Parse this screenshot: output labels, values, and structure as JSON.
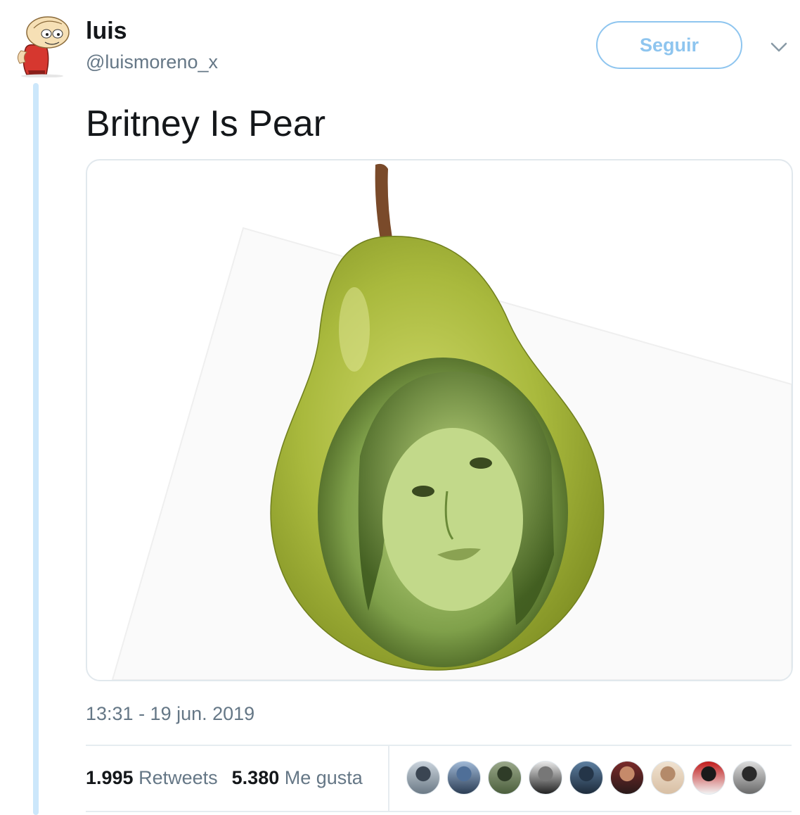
{
  "tweet": {
    "author": {
      "name": "luis",
      "handle": "@luismoreno_x",
      "avatar_icon": "cartoon-character-avatar"
    },
    "follow_label": "Seguir",
    "menu_icon": "chevron-down-icon",
    "text": "Britney Is Pear",
    "media": {
      "icon": "pear-photo"
    },
    "timestamp": "13:31 - 19 jun. 2019",
    "stats": {
      "retweets_count": "1.995",
      "retweets_label": "Retweets",
      "likes_count": "5.380",
      "likes_label": "Me gusta"
    },
    "likers": [
      {
        "colors": [
          "#c9d3dc",
          "#6c7a86",
          "#3a4552"
        ]
      },
      {
        "colors": [
          "#9fb8d6",
          "#2c3e55",
          "#4f6f98"
        ]
      },
      {
        "colors": [
          "#9aa88a",
          "#4c5f3d",
          "#2f3c28"
        ]
      },
      {
        "colors": [
          "#e8e8e8",
          "#222222",
          "#777777"
        ]
      },
      {
        "colors": [
          "#5d7fa0",
          "#1e2c3c",
          "#243548"
        ]
      },
      {
        "colors": [
          "#7a2a2a",
          "#2a1a1a",
          "#c68a6a"
        ]
      },
      {
        "colors": [
          "#f0e2d0",
          "#d8bfa4",
          "#b48a6a"
        ]
      },
      {
        "colors": [
          "#c01a1a",
          "#f2f2f2",
          "#1a1a1a"
        ]
      },
      {
        "colors": [
          "#dcdcdc",
          "#6a6a6a",
          "#2a2a2a"
        ]
      }
    ],
    "colors": {
      "follow_border": "#8ec5ef",
      "thread_line": "#cce7fb",
      "muted_text": "#657786",
      "primary_text": "#14171a"
    }
  }
}
